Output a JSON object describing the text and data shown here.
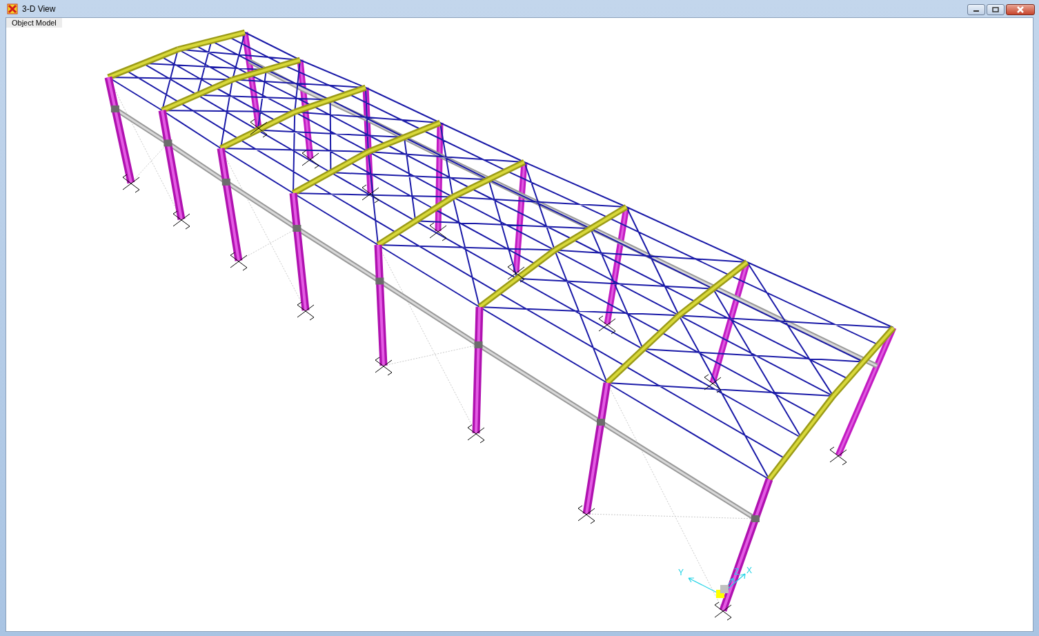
{
  "window": {
    "title": "3-D View"
  },
  "view_tab": {
    "label": "Object Model"
  },
  "axis_labels": [
    "Y",
    "Z",
    "X"
  ]
}
